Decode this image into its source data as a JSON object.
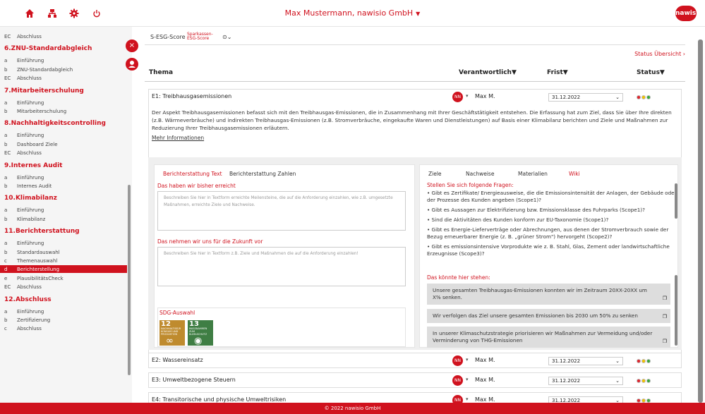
{
  "header": {
    "title": "Max Mustermann, nawisio GmbH",
    "caret": "▼",
    "icons": [
      "home-icon",
      "sitemap-icon",
      "gear-icon",
      "power-icon"
    ],
    "logo": "nawisio",
    "colors": {
      "brand": "#d0121e"
    }
  },
  "sidebar": {
    "rows": [
      {
        "kind": "item",
        "prefix": "EC",
        "label": "Abschluss"
      },
      {
        "kind": "head",
        "label": "6.ZNU-Standardabgleich"
      },
      {
        "kind": "item",
        "prefix": "a",
        "label": "Einführung"
      },
      {
        "kind": "item",
        "prefix": "b",
        "label": "ZNU-Standardabgleich"
      },
      {
        "kind": "item",
        "prefix": "EC",
        "label": "Abschluss"
      },
      {
        "kind": "head",
        "label": "7.Mitarbeiterschulung"
      },
      {
        "kind": "item",
        "prefix": "a",
        "label": "Einführung"
      },
      {
        "kind": "item",
        "prefix": "b",
        "label": "Mitarbeiterschulung"
      },
      {
        "kind": "head",
        "label": "8.Nachhaltigkeitscontrolling"
      },
      {
        "kind": "item",
        "prefix": "a",
        "label": "Einführung"
      },
      {
        "kind": "item",
        "prefix": "b",
        "label": "Dashboard Ziele"
      },
      {
        "kind": "item",
        "prefix": "EC",
        "label": "Abschluss"
      },
      {
        "kind": "head",
        "label": "9.Internes Audit"
      },
      {
        "kind": "item",
        "prefix": "a",
        "label": "Einführung"
      },
      {
        "kind": "item",
        "prefix": "b",
        "label": "Internes Audit"
      },
      {
        "kind": "head",
        "label": "10.Klimabilanz"
      },
      {
        "kind": "item",
        "prefix": "a",
        "label": "Einführung"
      },
      {
        "kind": "item",
        "prefix": "b",
        "label": "Klimabilanz"
      },
      {
        "kind": "head",
        "label": "11.Berichterstattung"
      },
      {
        "kind": "item",
        "prefix": "a",
        "label": "Einführung"
      },
      {
        "kind": "item",
        "prefix": "b",
        "label": "Standardauswahl"
      },
      {
        "kind": "item",
        "prefix": "c",
        "label": "Themenauswahl"
      },
      {
        "kind": "item",
        "prefix": "d",
        "label": "Berichterstellung",
        "active": true
      },
      {
        "kind": "item",
        "prefix": "e",
        "label": "PlausibilitätsCheck"
      },
      {
        "kind": "item",
        "prefix": "EC",
        "label": "Abschluss"
      },
      {
        "kind": "head",
        "label": "12.Abschluss"
      },
      {
        "kind": "item",
        "prefix": "a",
        "label": "Einführung"
      },
      {
        "kind": "item",
        "prefix": "b",
        "label": "Zertifizierung"
      },
      {
        "kind": "item",
        "prefix": "c",
        "label": "Abschluss"
      }
    ],
    "close_glyph": "×",
    "user_glyph": "👤"
  },
  "main": {
    "score_label": "S-ESG-Score",
    "score_mini": "Sparkassen-ESG-Score",
    "score_toggle": "⊙⌄",
    "status_link": "Status Übersicht ›",
    "columns": {
      "thema": "Thema",
      "verantwortlich": "Verantwortlich▼",
      "frist": "Frist▼",
      "status": "Status▼"
    },
    "expanded": {
      "title": "E1: Treibhausgasemissionen",
      "initials": "NN",
      "caret": "▾",
      "owner": "Max M.",
      "date": "31.12.2022",
      "date_caret": "⌄",
      "description": "Der Aspekt Treibhausgasemissionen befasst sich mit den Treibhausgas-Emissionen, die in Zusammenhang mit Ihrer Geschäftstätigkeit entstehen. Die Erfassung hat zum Ziel, dass Sie über Ihre direkten (z.B. Wärmeverbräuche) und indirekten Treibhausgas-Emissionen (z.B. Stromverbräuche, eingekaufte Waren und Dienstleistungen) auf Basis einer Klimabilanz berichten und Ziele und Maßnahmen zur Reduzierung Ihrer Treibhausgasemissionen erläutern.",
      "more": "Mehr Informationen",
      "left_tabs": [
        "Berichterstattung Text",
        "Berichterstattung Zahlen"
      ],
      "achieved_heading": "Das haben wir bisher erreicht",
      "achieved_placeholder": "Beschreiben Sie hier in Textform erreichte Meilensteine, die auf die Anforderung einzahlen, wie z.B. umgesetzte Maßnahmen, erreichte Ziele und Nachweise.",
      "future_heading": "Das nehmen wir uns für die Zukunft vor",
      "future_placeholder": "Beschreiben Sie hier in Textform z.B. Ziele und Maßnahmen die auf die Anforderung einzahlen!",
      "sdg_heading": "SDG-Auswahl",
      "sdgs": [
        {
          "num": "12",
          "text": "NACHHALTIGE/R KONSUM UND PRODUKTION",
          "symbol": "∞",
          "color": "#bf8b2e"
        },
        {
          "num": "13",
          "text": "MASSNAHMEN ZUM KLIMASCHUTZ",
          "symbol": "◉",
          "color": "#3f7e44"
        }
      ],
      "right_tabs": [
        "Ziele",
        "Nachweise",
        "Materialien",
        "Wiki"
      ],
      "questions_heading": "Stellen Sie sich folgende Fragen:",
      "questions": [
        "• Gibt es Zertifikate/ Energieausweise, die die Emissionsintensität der Anlagen, der Gebäude oder der Prozesse des Kunden angeben (Scope1)?",
        "• Gibt es Aussagen zur Elektrifizierung bzw. Emissionsklasse des Fuhrparks (Scope1)?",
        "• Sind die Aktivitäten des Kunden konform zur EU-Taxonomie (Scope1)?",
        "• Gibt es Energie-Lieferverträge oder Abrechnungen, aus denen der Stromverbrauch sowie der Bezug erneuerbarer Energie (z. B. „grüner Strom\") hervorgeht (Scope2)?",
        "• Gibt es emissionsintensive Vorprodukte wie z. B. Stahl, Glas, Zement oder landwirtschaftliche Erzeugnisse (Scope3)?"
      ],
      "suggestions_heading": "Das könnte hier stehen:",
      "suggestions": [
        "Unsere gesamten Treibhausgas-Emissionen konnten wir im Zeitraum 20XX-20XX um X% senken.",
        "Wir verfolgen das Ziel unsere gesamten Emissionen bis 2030 um 50% zu senken",
        "In unserer Klimaschutzstrategie priorisieren wir Maßnahmen zur Vermeidung und/oder Verminderung von THG-Emissionen"
      ],
      "copy_glyph": "❐"
    },
    "rows": [
      {
        "title": "E2: Wassereinsatz",
        "initials": "NN",
        "owner": "Max M.",
        "date": "31.12.2022"
      },
      {
        "title": "E3: Umweltbezogene Steuern",
        "initials": "NN",
        "owner": "Max M.",
        "date": "31.12.2022"
      },
      {
        "title": "E4: Transitorische und physische Umweltrisiken",
        "initials": "NN",
        "owner": "Max M.",
        "date": "31.12.2022"
      }
    ],
    "status_colors": {
      "red": "#e0242c",
      "yellow": "#f2c200",
      "green": "#3aa83a"
    }
  },
  "footer": {
    "text": "© 2022 nawisio GmbH"
  }
}
